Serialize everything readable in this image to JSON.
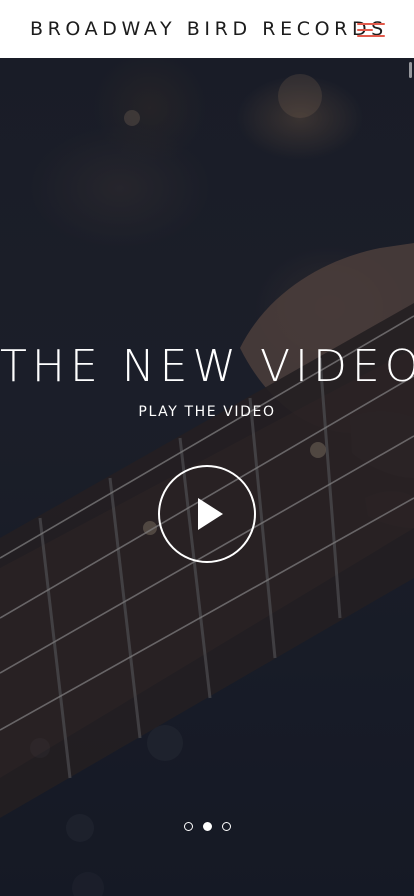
{
  "header": {
    "brand": "BROADWAY BIRD RECORDS",
    "menu_icon": "hamburger-menu-icon",
    "accent_color": "#e25a4b"
  },
  "hero": {
    "title": "THE NEW VIDEO",
    "subtitle": "PLAY THE VIDEO",
    "play_icon": "play-icon"
  },
  "slider": {
    "count": 3,
    "active_index": 1
  }
}
